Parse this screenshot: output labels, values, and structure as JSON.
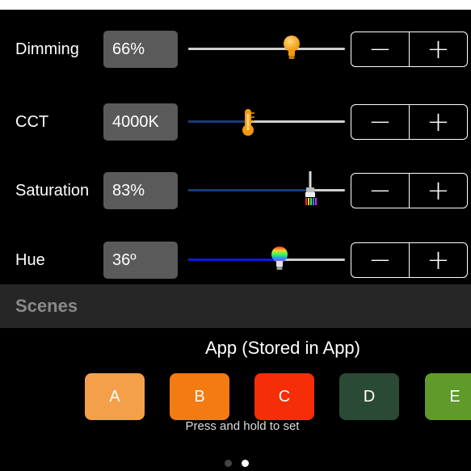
{
  "controls": {
    "dimming": {
      "label": "Dimming",
      "value": "66%",
      "level": 0.66,
      "fill_color": "#cfcfcf",
      "thumb_icon": "lightbulb-icon"
    },
    "cct": {
      "label": "CCT",
      "value": "4000K",
      "level": 0.38,
      "fill_color": "#1d3a78",
      "thumb_icon": "thermometer-icon"
    },
    "saturation": {
      "label": "Saturation",
      "value": "83%",
      "level": 0.78,
      "fill_color": "#1d3a78",
      "thumb_icon": "paintbrush-icon"
    },
    "hue": {
      "label": "Hue",
      "value": "36º",
      "level": 0.58,
      "fill_color": "#0a1bd8",
      "thumb_icon": "rainbow-bulb-icon"
    }
  },
  "stepper": {
    "minus": "−",
    "plus": "+"
  },
  "scenes": {
    "header": "Scenes",
    "group_title": "App (Stored in App)",
    "hint": "Press and hold to set",
    "tiles": [
      {
        "label": "A",
        "color": "#f4a04a"
      },
      {
        "label": "B",
        "color": "#f47a12"
      },
      {
        "label": "C",
        "color": "#f52e08"
      },
      {
        "label": "D",
        "color": "#2b4a36"
      },
      {
        "label": "E",
        "color": "#5f9a2a"
      }
    ]
  },
  "pagination": {
    "total": 2,
    "active_index": 1,
    "active_color": "#ffffff",
    "inactive_color": "#444444"
  }
}
